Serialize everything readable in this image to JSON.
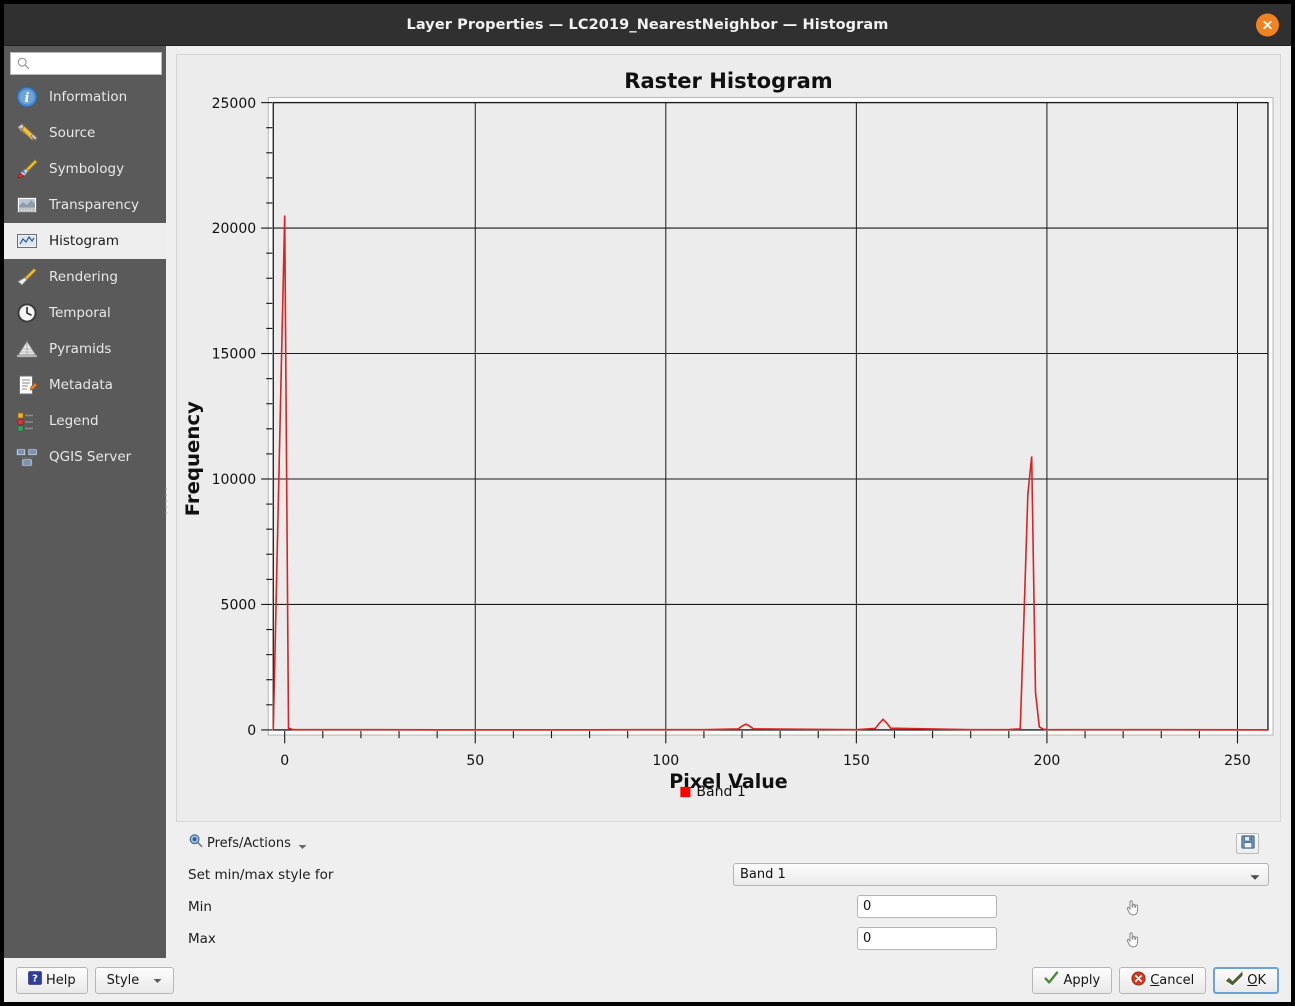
{
  "window": {
    "title": "Layer Properties — LC2019_NearestNeighbor — Histogram",
    "close_icon": "close-icon"
  },
  "sidebar": {
    "search": {
      "value": "",
      "placeholder": "",
      "icon": "search-icon"
    },
    "items": [
      {
        "label": "Information",
        "icon": "information-icon",
        "selected": false
      },
      {
        "label": "Source",
        "icon": "source-icon",
        "selected": false
      },
      {
        "label": "Symbology",
        "icon": "symbology-icon",
        "selected": false
      },
      {
        "label": "Transparency",
        "icon": "transparency-icon",
        "selected": false
      },
      {
        "label": "Histogram",
        "icon": "histogram-icon",
        "selected": true
      },
      {
        "label": "Rendering",
        "icon": "rendering-icon",
        "selected": false
      },
      {
        "label": "Temporal",
        "icon": "temporal-icon",
        "selected": false
      },
      {
        "label": "Pyramids",
        "icon": "pyramids-icon",
        "selected": false
      },
      {
        "label": "Metadata",
        "icon": "metadata-icon",
        "selected": false
      },
      {
        "label": "Legend",
        "icon": "legend-icon",
        "selected": false
      },
      {
        "label": "QGIS Server",
        "icon": "qgis-server-icon",
        "selected": false
      }
    ]
  },
  "chart_data": {
    "type": "line",
    "title": "Raster Histogram",
    "xlabel": "Pixel Value",
    "ylabel": "Frequency",
    "xlim": [
      -3,
      258
    ],
    "ylim": [
      0,
      25000
    ],
    "xticks": [
      0,
      50,
      100,
      150,
      200,
      250
    ],
    "yticks": [
      0,
      5000,
      10000,
      15000,
      20000,
      25000
    ],
    "xminor_step": 10,
    "yminor_step": 1000,
    "grid": true,
    "legend": {
      "position": "bottom",
      "entries": [
        {
          "name": "Band 1",
          "color": "#ff0000"
        }
      ]
    },
    "series": [
      {
        "name": "Band 1",
        "color": "#dd2222",
        "x": [
          0,
          1,
          2,
          3,
          40,
          80,
          110,
          119,
          120,
          121,
          122,
          123,
          150,
          155,
          156,
          157,
          158,
          159,
          180,
          190,
          193,
          194,
          195,
          196,
          197,
          198,
          199,
          200,
          210,
          230,
          255
        ],
        "values": [
          20500,
          70,
          20,
          10,
          5,
          5,
          10,
          40,
          150,
          230,
          150,
          40,
          10,
          60,
          260,
          420,
          270,
          70,
          10,
          15,
          40,
          4600,
          9400,
          10900,
          1500,
          120,
          30,
          15,
          10,
          8,
          5
        ]
      }
    ]
  },
  "controls": {
    "prefs_actions": {
      "label": "Prefs/Actions",
      "icon": "magnifier-icon",
      "chevron": "chevron-down-icon"
    },
    "save_button": {
      "icon": "save-icon"
    },
    "minmax_label": "Set min/max style for",
    "band_select": {
      "value": "Band 1",
      "options": [
        "Band 1"
      ]
    },
    "min": {
      "label": "Min",
      "value": "0"
    },
    "max": {
      "label": "Max",
      "value": "0"
    },
    "pick_icon": "pointer-hand-icon"
  },
  "footer": {
    "help": "Help",
    "style": "Style",
    "apply": "Apply",
    "cancel_pre": "",
    "cancel_accel": "C",
    "cancel_post": "ancel",
    "ok_accel": "O",
    "ok_post": "K"
  },
  "colors": {
    "accent_line": "#dd2222",
    "legend_swatch": "#ff0000",
    "close": "#f08222",
    "titlebar": "#303030",
    "sidebar": "#5a5a5a"
  }
}
